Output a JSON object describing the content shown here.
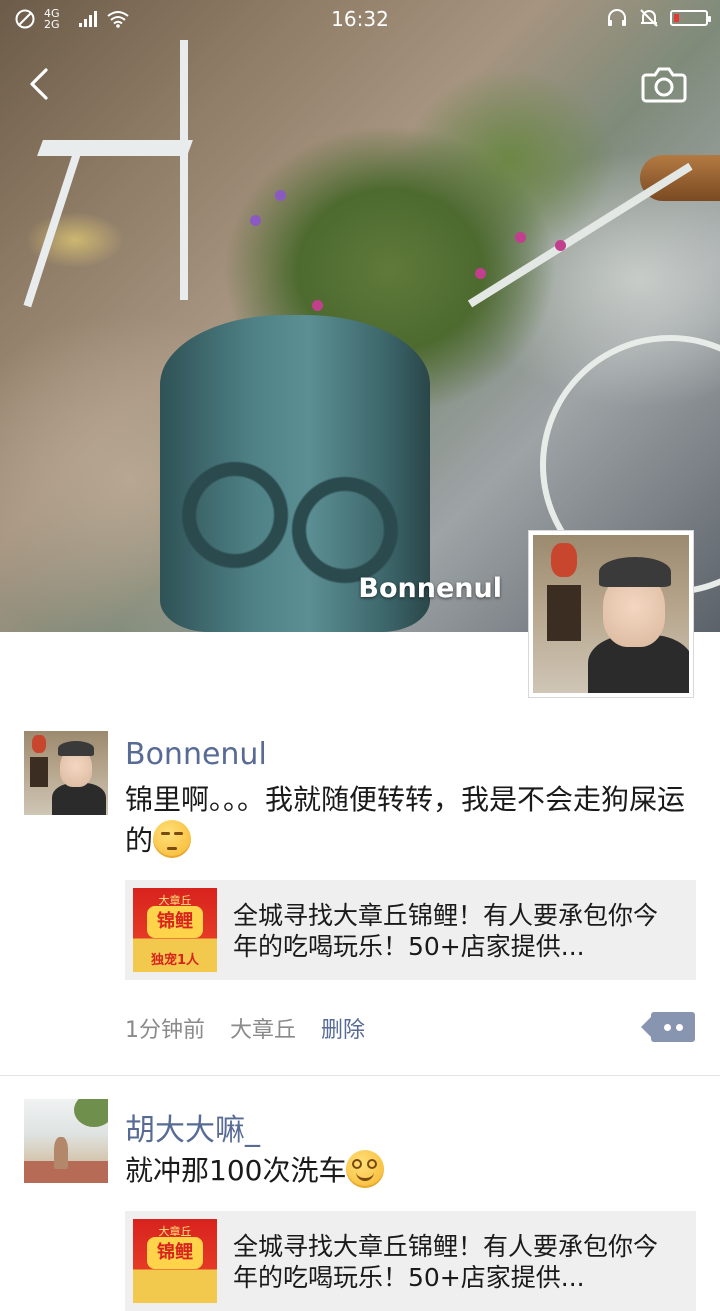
{
  "status_bar": {
    "time": "16:32",
    "network_type": "4G 2G",
    "battery_color": "#e53935",
    "battery_level": 0.15
  },
  "header": {
    "back_icon": "chevron-left-icon",
    "camera_icon": "camera-icon"
  },
  "profile": {
    "name": "Bonnenul"
  },
  "posts": [
    {
      "author": "Bonnenul",
      "text": "锦里啊。。。我就随便转转，我是不会走狗屎运的",
      "emoji": "unamused-face",
      "link": {
        "thumb_top": "大章丘",
        "thumb_main": "锦鲤",
        "thumb_bottom": "独宠1人",
        "title": "全城寻找大章丘锦鲤！有人要承包你今年的吃喝玩乐！50+店家提供..."
      },
      "time": "1分钟前",
      "location": "大章丘",
      "delete_label": "删除"
    },
    {
      "author": "胡大大嘛_",
      "text": "就冲那100次洗车",
      "emoji": "grinning-face",
      "link": {
        "thumb_top": "大章丘",
        "thumb_main": "锦鲤",
        "title": "全城寻找大章丘锦鲤！有人要承包你今年的吃喝玩乐！50+店家提供..."
      }
    }
  ],
  "colors": {
    "name_link": "#576b95",
    "more_button": "#8895b1"
  }
}
